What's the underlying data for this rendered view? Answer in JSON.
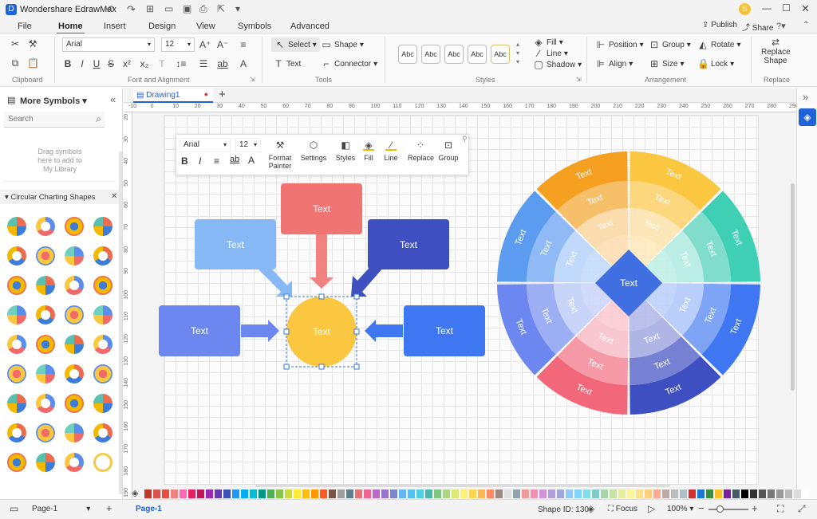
{
  "app": {
    "title": "Wondershare EdrawMax",
    "user_initial": "S",
    "publish": "Publish",
    "share": "Share"
  },
  "menu_tabs": [
    "File",
    "Home",
    "Insert",
    "Design",
    "View",
    "Symbols",
    "Advanced"
  ],
  "ribbon": {
    "font_name": "Arial",
    "font_size": "12",
    "select": "Select",
    "shape": "Shape",
    "text": "Text",
    "connector": "Connector",
    "style_samples": [
      "Abc",
      "Abc",
      "Abc",
      "Abc",
      "Abc"
    ],
    "fill": "Fill",
    "line": "Line",
    "shadow": "Shadow",
    "position": "Position",
    "group": "Group",
    "rotate": "Rotate",
    "align": "Align",
    "size": "Size",
    "lock": "Lock",
    "replace_shape": [
      "Replace",
      "Shape"
    ],
    "groups": [
      "Clipboard",
      "Font and Alignment",
      "Tools",
      "Styles",
      "Arrangement",
      "Replace"
    ]
  },
  "left_panel": {
    "title": "More Symbols",
    "search_placeholder": "Search",
    "library_hint": [
      "Drag symbols",
      "here to add to",
      "My Library"
    ],
    "category": "Circular Charting Shapes"
  },
  "document_tab": "Drawing1",
  "ruler_h": [
    "-10",
    "0",
    "10",
    "20",
    "30",
    "40",
    "50",
    "60",
    "70",
    "80",
    "90",
    "100",
    "110",
    "120",
    "130",
    "140",
    "150",
    "160",
    "170",
    "180",
    "190",
    "200",
    "210",
    "220",
    "230",
    "240",
    "250",
    "260",
    "270",
    "280",
    "290"
  ],
  "ruler_v": [
    "20",
    "30",
    "40",
    "50",
    "60",
    "70",
    "80",
    "90",
    "100",
    "110",
    "120",
    "130",
    "140",
    "150",
    "160",
    "170",
    "180",
    "190",
    "200"
  ],
  "floating_toolbar": {
    "font_name": "Arial",
    "font_size": "12",
    "buttons": [
      [
        "Format",
        "Painter"
      ],
      [
        "Settings"
      ],
      [
        "Styles"
      ],
      [
        "Fill"
      ],
      [
        "Line"
      ],
      [
        "Replace"
      ],
      [
        "Group"
      ]
    ]
  },
  "diagram": {
    "label": "Text",
    "colors": {
      "red": "#f07472",
      "lightblue": "#86b8f5",
      "navy": "#3d4fc1",
      "periwinkle": "#6c88f0",
      "blue": "#3f77f2",
      "yellow": "#fbc640"
    }
  },
  "wheel": {
    "label": "Text",
    "center_label": "Text"
  },
  "status": {
    "page_selector": "Page-1",
    "page_tab": "Page-1",
    "shape_id": "Shape ID: 130",
    "focus": "Focus",
    "zoom": "100%"
  },
  "palette": [
    "#c0392b",
    "#d9534f",
    "#e74c3c",
    "#f08080",
    "#ff69b4",
    "#e91e63",
    "#c2185b",
    "#9c27b0",
    "#673ab7",
    "#3f51b5",
    "#2196f3",
    "#03a9f4",
    "#00bcd4",
    "#009688",
    "#4caf50",
    "#8bc34a",
    "#cddc39",
    "#ffeb3b",
    "#ffc107",
    "#ff9800",
    "#ff5722",
    "#795548",
    "#9e9e9e",
    "#607d8b",
    "#e57373",
    "#f06292",
    "#ba68c8",
    "#9575cd",
    "#7986cb",
    "#64b5f6",
    "#4fc3f7",
    "#4dd0e1",
    "#4db6ac",
    "#81c784",
    "#aed581",
    "#dce775",
    "#fff176",
    "#ffd54f",
    "#ffb74d",
    "#ff8a65",
    "#a1887f",
    "#e0e0e0",
    "#90a4ae",
    "#ef9a9a",
    "#f48fb1",
    "#ce93d8",
    "#b39ddb",
    "#9fa8da",
    "#90caf9",
    "#81d4fa",
    "#80deea",
    "#80cbc4",
    "#a5d6a7",
    "#c5e1a5",
    "#e6ee9c",
    "#fff59d",
    "#ffe082",
    "#ffcc80",
    "#ffab91",
    "#bcaaa4",
    "#bdbdbd",
    "#b0bec5",
    "#d32f2f",
    "#1976d2",
    "#388e3c",
    "#fbc02d",
    "#7b1fa2",
    "#455a64",
    "#000000",
    "#333333",
    "#555555",
    "#777777",
    "#999999",
    "#bbbbbb",
    "#dddddd",
    "#ffffff"
  ]
}
